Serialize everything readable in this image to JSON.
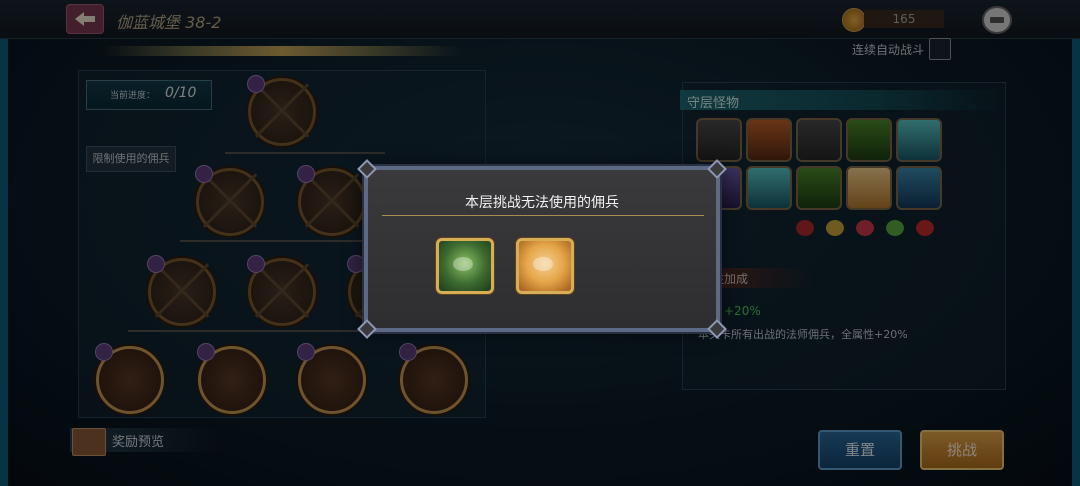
{
  "header": {
    "title": "伽蓝城堡 38-2",
    "currency_value": "165",
    "auto_battle_label": "连续自动战斗"
  },
  "progress": {
    "label": "当前进度：",
    "value": "0/10"
  },
  "limit_button": "限制使用的佣兵",
  "monsters": {
    "title": "守层怪物"
  },
  "bonus": {
    "title": "注加成",
    "percent": "+20%",
    "description": "本关卡所有出战的法师佣兵，全属性+20%"
  },
  "footer": {
    "reward_label": "奖励预览",
    "reset_label": "重置",
    "challenge_label": "挑战"
  },
  "modal": {
    "title": "本层挑战无法使用的佣兵"
  },
  "colors": {
    "accent_gold": "#d7ad55",
    "reset_blue": "#2a6a9a",
    "challenge_orange": "#e3a446",
    "bonus_green": "#4fc458"
  }
}
